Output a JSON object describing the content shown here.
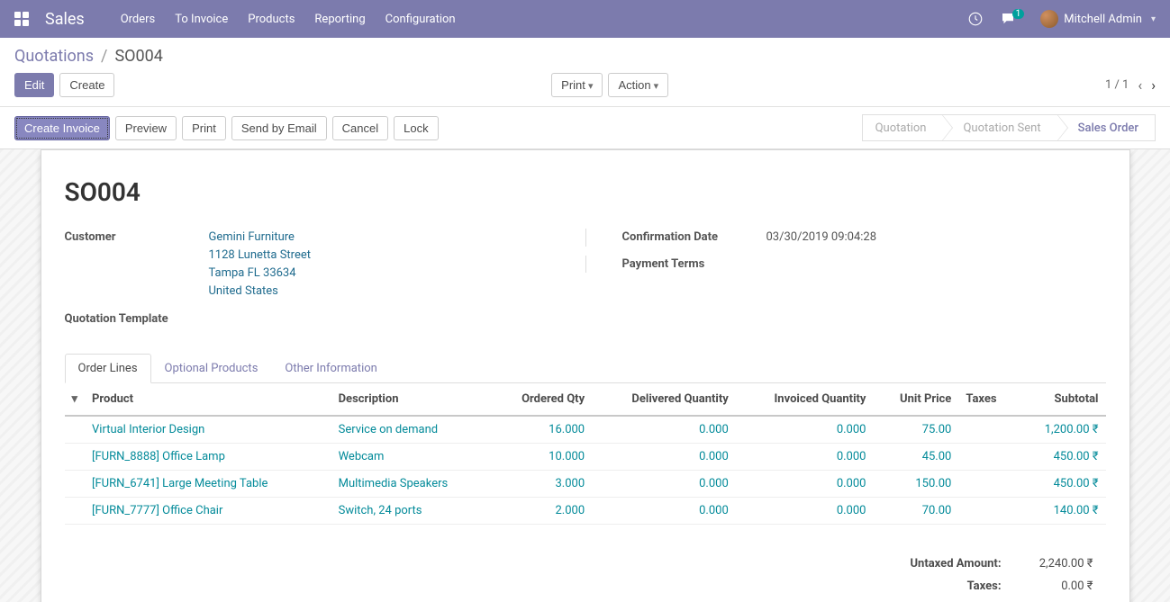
{
  "navbar": {
    "brand": "Sales",
    "links": [
      "Orders",
      "To Invoice",
      "Products",
      "Reporting",
      "Configuration"
    ],
    "msg_count": "1",
    "user": "Mitchell Admin"
  },
  "breadcrumb": {
    "root": "Quotations",
    "sep": "/",
    "current": "SO004"
  },
  "cp": {
    "edit": "Edit",
    "create": "Create",
    "print": "Print",
    "action": "Action",
    "pager": "1 / 1"
  },
  "actions": {
    "create_invoice": "Create Invoice",
    "preview": "Preview",
    "print": "Print",
    "send_email": "Send by Email",
    "cancel": "Cancel",
    "lock": "Lock"
  },
  "status": {
    "s1": "Quotation",
    "s2": "Quotation Sent",
    "s3": "Sales Order"
  },
  "form": {
    "title": "SO004",
    "customer_label": "Customer",
    "customer_name": "Gemini Furniture",
    "customer_addr1": "1128 Lunetta Street",
    "customer_addr2": "Tampa FL 33634",
    "customer_country": "United States",
    "template_label": "Quotation Template",
    "confirm_label": "Confirmation Date",
    "confirm_value": "03/30/2019 09:04:28",
    "terms_label": "Payment Terms"
  },
  "tabs": {
    "t1": "Order Lines",
    "t2": "Optional Products",
    "t3": "Other Information"
  },
  "table": {
    "headers": {
      "product": "Product",
      "description": "Description",
      "ordered": "Ordered Qty",
      "delivered": "Delivered Quantity",
      "invoiced": "Invoiced Quantity",
      "unit_price": "Unit Price",
      "taxes": "Taxes",
      "subtotal": "Subtotal"
    },
    "rows": [
      {
        "product": "Virtual Interior Design",
        "description": "Service on demand",
        "ordered": "16.000",
        "delivered": "0.000",
        "invoiced": "0.000",
        "unit_price": "75.00",
        "taxes": "",
        "subtotal": "1,200.00 ₹"
      },
      {
        "product": "[FURN_8888] Office Lamp",
        "description": "Webcam",
        "ordered": "10.000",
        "delivered": "0.000",
        "invoiced": "0.000",
        "unit_price": "45.00",
        "taxes": "",
        "subtotal": "450.00 ₹"
      },
      {
        "product": "[FURN_6741] Large Meeting Table",
        "description": "Multimedia Speakers",
        "ordered": "3.000",
        "delivered": "0.000",
        "invoiced": "0.000",
        "unit_price": "150.00",
        "taxes": "",
        "subtotal": "450.00 ₹"
      },
      {
        "product": "[FURN_7777] Office Chair",
        "description": "Switch, 24 ports",
        "ordered": "2.000",
        "delivered": "0.000",
        "invoiced": "0.000",
        "unit_price": "70.00",
        "taxes": "",
        "subtotal": "140.00 ₹"
      }
    ]
  },
  "totals": {
    "untaxed_label": "Untaxed Amount:",
    "untaxed_value": "2,240.00 ₹",
    "taxes_label": "Taxes:",
    "taxes_value": "0.00 ₹"
  }
}
